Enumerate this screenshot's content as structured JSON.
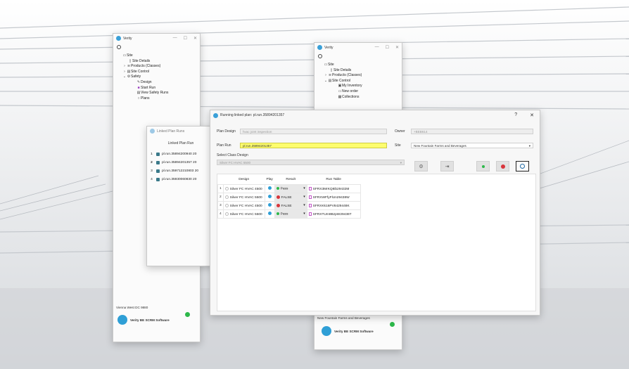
{
  "window_left": {
    "app_title": "Verity",
    "tree": [
      {
        "label": "Site",
        "level": 0
      },
      {
        "label": "Site Details",
        "level": 1
      },
      {
        "label": "Products (Classes)",
        "level": 1
      },
      {
        "label": "Site Control",
        "level": 1
      },
      {
        "label": "Safety",
        "level": 1
      },
      {
        "label": "Design",
        "level": 2
      },
      {
        "label": "Start Run",
        "level": 2
      },
      {
        "label": "View Safety Runs",
        "level": 2
      },
      {
        "label": "Plans",
        "level": 2
      }
    ],
    "site_name": "Vienna West DC 9880",
    "brand": "Verity BE SCRM Software"
  },
  "window_right": {
    "app_title": "Verity",
    "tree": [
      {
        "label": "Site",
        "level": 0
      },
      {
        "label": "Site Details",
        "level": 1
      },
      {
        "label": "Products (Classes)",
        "level": 1
      },
      {
        "label": "Site Control",
        "level": 1
      },
      {
        "label": "My Inventory",
        "level": 2
      },
      {
        "label": "New order",
        "level": 2
      },
      {
        "label": "Collections",
        "level": 2
      }
    ],
    "site_name": "New Fountain Farms and Beverages",
    "brand": "Verity BE SCRM Software"
  },
  "linked_plan_runs": {
    "title": "Linked Plan Runs",
    "column_header": "Linked Plan Run",
    "rows": [
      {
        "num": "1",
        "run": "pl.run.35894200940",
        "extra": "20"
      },
      {
        "num": "2",
        "run": "pl.run.35894201357",
        "extra": "20"
      },
      {
        "num": "3",
        "run": "pl.run.359712210803",
        "extra": "20"
      },
      {
        "num": "4",
        "run": "pl.run.35930060830",
        "extra": "20"
      }
    ]
  },
  "main_dialog": {
    "title": "Running linked plan: pl.run.35894201357",
    "help": "?",
    "close": "✕",
    "plan_design_label": "Plan Design",
    "plan_design_value": "hvac joint inspection",
    "owner_label": "Owner",
    "owner_value": "+BEB614",
    "plan_run_label": "Plan Run",
    "plan_run_value": "pl.run.35894201357",
    "site_label": "Site",
    "site_value": "New Fountain Farms and Beverages",
    "select_class_design_label": "Select Class Design",
    "class_design_value": "Silver FC HVAC 5500",
    "table": {
      "headers": [
        "Design",
        "Play",
        "Result",
        "Run Table"
      ],
      "rows": [
        {
          "num": "1",
          "design": "Silver FC HVAC 4500",
          "result": "Pass",
          "run_table": "SFRX3MrKQ8ib29432M"
        },
        {
          "num": "2",
          "design": "Silver FC HVAC 5500",
          "result": "FALSE",
          "run_table": "SFRXWFfyFlUn29438W"
        },
        {
          "num": "3",
          "design": "Silver FC HVAC 4500",
          "result": "FALSE",
          "run_table": "SFRXKk16PV8429448K"
        },
        {
          "num": "4",
          "design": "Silver FC HVAC 5500",
          "result": "Pass",
          "run_table": "SFRXTUm9BzpW29436T"
        }
      ]
    }
  },
  "colors": {
    "accent_blue": "#2f9fd6",
    "pass_green": "#2db84a",
    "fail_red": "#d8353b",
    "highlight_yellow": "#fefd6e"
  }
}
